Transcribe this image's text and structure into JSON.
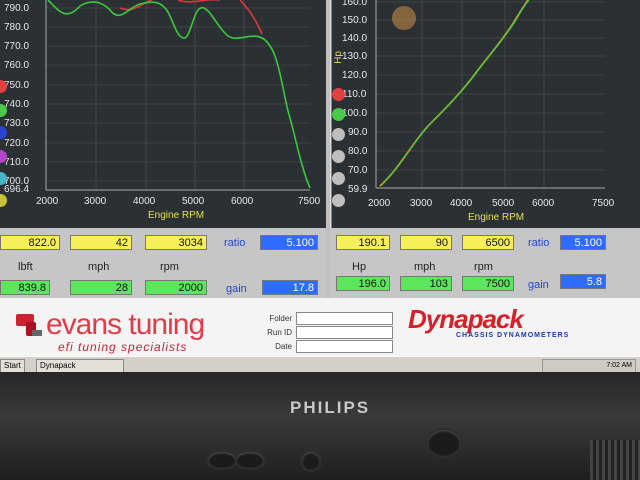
{
  "left_graph": {
    "y_ticks": [
      "790.0",
      "780.0",
      "770.0",
      "760.0",
      "750.0",
      "740.0",
      "730.0",
      "720.0",
      "710.0",
      "700.0",
      "696.4"
    ],
    "x_ticks": [
      "2000",
      "3000",
      "4000",
      "5000",
      "6000",
      "7500"
    ],
    "x_label": "Engine RPM"
  },
  "right_graph": {
    "y_ticks": [
      "160.0",
      "150.0",
      "140.0",
      "130.0",
      "120.0",
      "110.0",
      "100.0",
      "90.0",
      "80.0",
      "70.0",
      "59.9"
    ],
    "y_label": "Hp",
    "x_ticks": [
      "2000",
      "3000",
      "4000",
      "5000",
      "6000",
      "7500"
    ],
    "x_label": "Engine RPM"
  },
  "left_panel": {
    "row1": {
      "v1": "822.0",
      "v2": "42",
      "v3": "3034",
      "ratio_label": "ratio",
      "ratio": "5.100"
    },
    "labels": {
      "a": "lbft",
      "b": "mph",
      "c": "rpm"
    },
    "row2": {
      "v1": "839.8",
      "v2": "28",
      "v3": "2000",
      "gain_label": "gain",
      "gain": "17.8"
    }
  },
  "right_panel": {
    "row1": {
      "v1": "190.1",
      "v2": "90",
      "v3": "6500",
      "ratio_label": "ratio",
      "ratio": "5.100"
    },
    "labels": {
      "a": "Hp",
      "b": "mph",
      "c": "rpm"
    },
    "row2": {
      "v1": "196.0",
      "v2": "103",
      "v3": "7500",
      "gain_label": "gain",
      "gain": "5.8"
    }
  },
  "footer": {
    "logo_main": "evans tuning",
    "logo_sub": "efi tuning specialists",
    "folder_label": "Folder",
    "runid_label": "Run ID",
    "date_label": "Date",
    "dyna_brand": "Dynapack",
    "dyna_sub": "CHASSIS DYNAMOMETERS"
  },
  "taskbar": {
    "start": "Start",
    "app": "Dynapack",
    "time": "7:02 AM"
  },
  "monitor": {
    "brand": "PHILIPS"
  },
  "colors": {
    "curve_red": "#d83a3a",
    "curve_green": "#3cc83c",
    "curve_orange": "#d2a02a",
    "accent_blue": "#2e6bff"
  }
}
